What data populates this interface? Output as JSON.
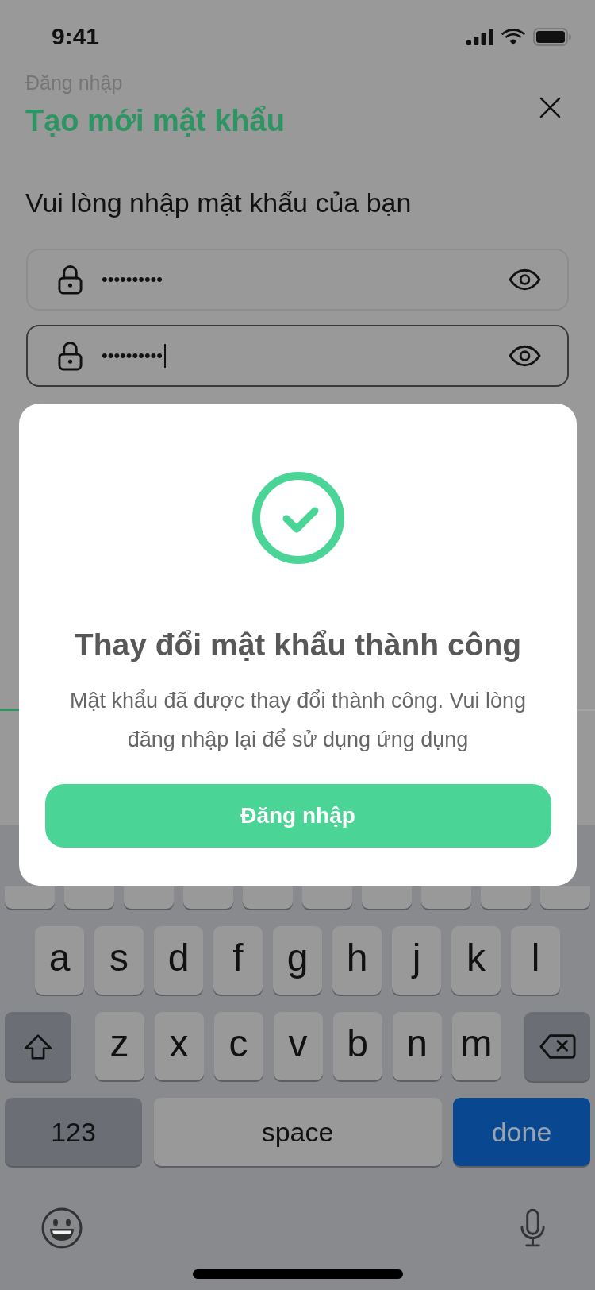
{
  "status_bar": {
    "time": "9:41"
  },
  "header": {
    "breadcrumb": "Đăng nhập",
    "title": "Tạo mới mật khẩu"
  },
  "form": {
    "prompt": "Vui lòng nhập mật khẩu của bạn",
    "fields": [
      {
        "value": "••••••••••",
        "focused": false
      },
      {
        "value": "••••••••••",
        "focused": true
      }
    ]
  },
  "dialog": {
    "title": "Thay đổi mật khẩu thành công",
    "message": "Mật khẩu đã được thay đổi thành công. Vui lòng đăng nhập lại để sử dụng ứng dụng",
    "button": "Đăng nhập"
  },
  "keyboard": {
    "second_row": [
      {
        "kind": "letter",
        "label": "a"
      },
      {
        "kind": "letter",
        "label": "s"
      },
      {
        "kind": "letter",
        "label": "d"
      },
      {
        "kind": "letter",
        "label": "f"
      },
      {
        "kind": "letter",
        "label": "g"
      },
      {
        "kind": "letter",
        "label": "h"
      },
      {
        "kind": "letter",
        "label": "j"
      },
      {
        "kind": "letter",
        "label": "k"
      },
      {
        "kind": "letter",
        "label": "l"
      }
    ],
    "third_row": [
      {
        "kind": "shift"
      },
      {
        "kind": "letter",
        "label": "z"
      },
      {
        "kind": "letter",
        "label": "x"
      },
      {
        "kind": "letter",
        "label": "c"
      },
      {
        "kind": "letter",
        "label": "v"
      },
      {
        "kind": "letter",
        "label": "b"
      },
      {
        "kind": "letter",
        "label": "n"
      },
      {
        "kind": "letter",
        "label": "m"
      },
      {
        "kind": "backspace"
      }
    ],
    "bottom_row": [
      {
        "kind": "mode",
        "label": "123"
      },
      {
        "kind": "space",
        "label": "space"
      },
      {
        "kind": "done",
        "label": "done"
      }
    ]
  }
}
